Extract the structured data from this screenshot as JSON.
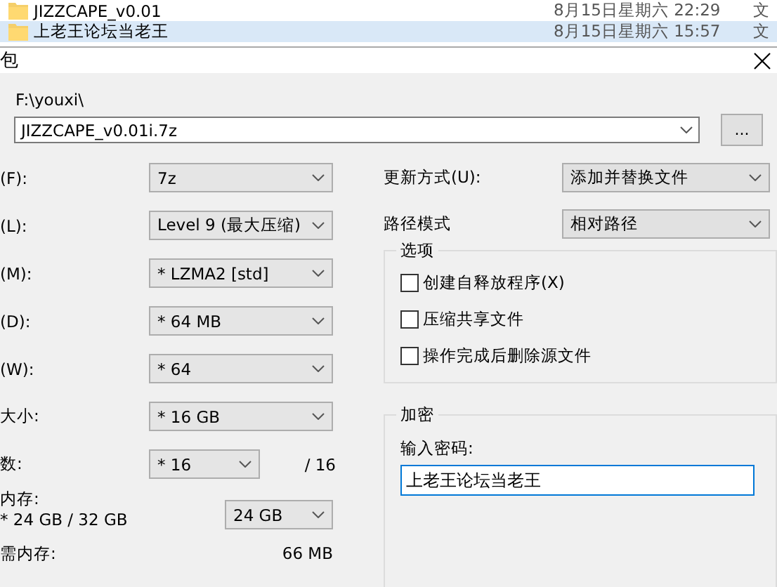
{
  "file_list": [
    {
      "name": "JIZZCAPE_v0.01",
      "date": "8月15日星期六 22:29",
      "column_3": "文",
      "selected": false
    },
    {
      "name": "上老王论坛当老王",
      "date": "8月15日星期六 15:57",
      "column_3": "文",
      "selected": true
    }
  ],
  "dialog": {
    "title": "包",
    "path_label": "F:\\youxi\\",
    "archive": "JIZZCAPE_v0.01i.7z",
    "browse": "...",
    "left_fields": [
      {
        "kind": "combo",
        "label": "(F):",
        "value": "7z"
      },
      {
        "kind": "combo",
        "label": "(L):",
        "value": "Level 9 (最大压缩)"
      },
      {
        "kind": "combo",
        "label": "(M):",
        "value": "* LZMA2 [std]"
      },
      {
        "kind": "combo",
        "label": "(D):",
        "value": "* 64 MB"
      },
      {
        "kind": "combo",
        "label": "(W):",
        "value": "* 64"
      },
      {
        "kind": "combo",
        "label": "大小:",
        "value": "* 16 GB"
      },
      {
        "kind": "short",
        "label": "数:",
        "value": "* 16",
        "suffix": "/ 16"
      }
    ],
    "memory": {
      "label": "内存:",
      "detail": "* 24 GB / 32 GB",
      "value": "24 GB"
    },
    "decompress": {
      "label": "需内存:",
      "value": "66 MB"
    },
    "update_mode": {
      "label": "更新方式(U):",
      "value": "添加并替换文件"
    },
    "path_mode": {
      "label": "路径模式",
      "value": "相对路径"
    },
    "options": {
      "title": "选项",
      "items": [
        {
          "label": "创建自释放程序(X)",
          "checked": false
        },
        {
          "label": "压缩共享文件",
          "checked": false
        },
        {
          "label": "操作完成后删除源文件",
          "checked": false
        }
      ]
    },
    "encryption": {
      "title": "加密",
      "label": "输入密码:",
      "value": "上老王论坛当老王"
    }
  }
}
